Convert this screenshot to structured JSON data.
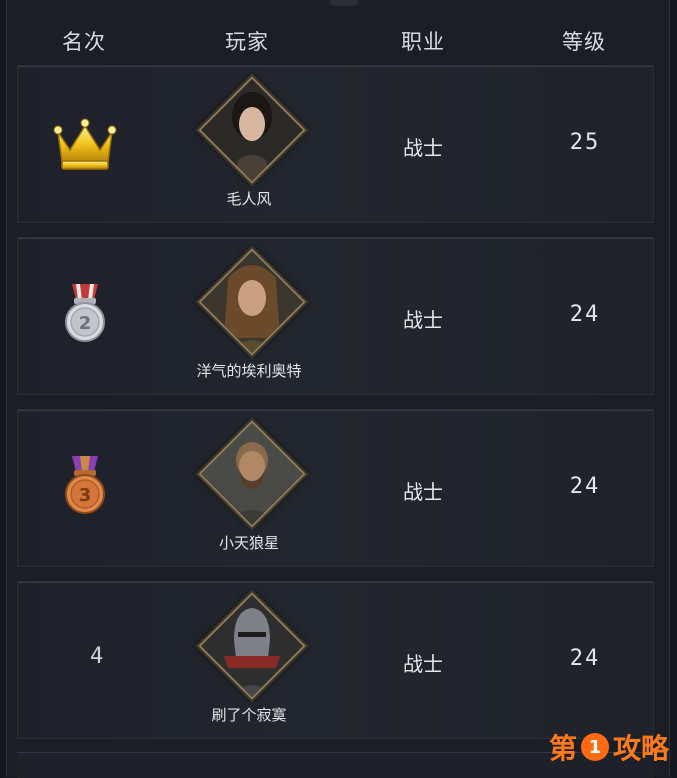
{
  "header": {
    "rank": "名次",
    "player": "玩家",
    "job": "职业",
    "level": "等级"
  },
  "rows": [
    {
      "rank_icon": "gold-crown-icon",
      "rank_label": "",
      "name": "毛人风",
      "job": "战士",
      "level": "25",
      "portrait": "female-warrior-portrait"
    },
    {
      "rank_icon": "silver-medal-icon",
      "rank_label": "2",
      "name": "洋气的埃利奥特",
      "job": "战士",
      "level": "24",
      "portrait": "long-hair-warrior-portrait"
    },
    {
      "rank_icon": "bronze-medal-icon",
      "rank_label": "3",
      "name": "小天狼星",
      "job": "战士",
      "level": "24",
      "portrait": "bearded-warrior-portrait"
    },
    {
      "rank_icon": "",
      "rank_label": "4",
      "name": "刷了个寂寞",
      "job": "战士",
      "level": "24",
      "portrait": "helmet-knight-portrait"
    }
  ],
  "watermark": {
    "left": "第",
    "number": "1",
    "right": "攻略"
  },
  "colors": {
    "gold": "#f2c21b",
    "silver": "#c9ccd2",
    "bronze": "#d4753a",
    "frame_border": "#8c7a5a",
    "watermark": "#ff7a1a"
  }
}
